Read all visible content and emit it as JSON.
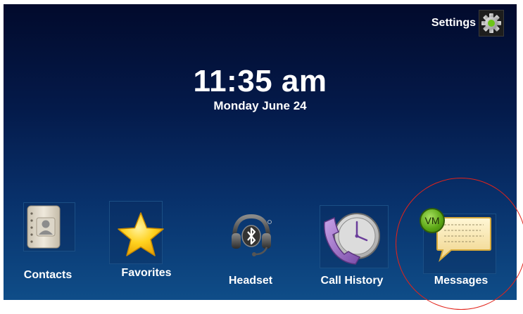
{
  "header": {
    "settings_label": "Settings",
    "settings_icon": "gear-icon"
  },
  "clock": {
    "time": "11:35 am",
    "date": "Monday June 24"
  },
  "apps": [
    {
      "label": "Contacts",
      "icon": "address-book-icon"
    },
    {
      "label": "Favorites",
      "icon": "star-icon"
    },
    {
      "label": "Headset",
      "icon": "bluetooth-headset-icon"
    },
    {
      "label": "Call History",
      "icon": "clock-phone-icon"
    },
    {
      "label": "Messages",
      "icon": "message-bubble-icon",
      "badge": "VM"
    }
  ],
  "colors": {
    "background_top": "#020a2c",
    "background_bottom": "#0f4d88",
    "text": "#ffffff",
    "highlight": "#e2231a",
    "badge": "#5aa514"
  }
}
